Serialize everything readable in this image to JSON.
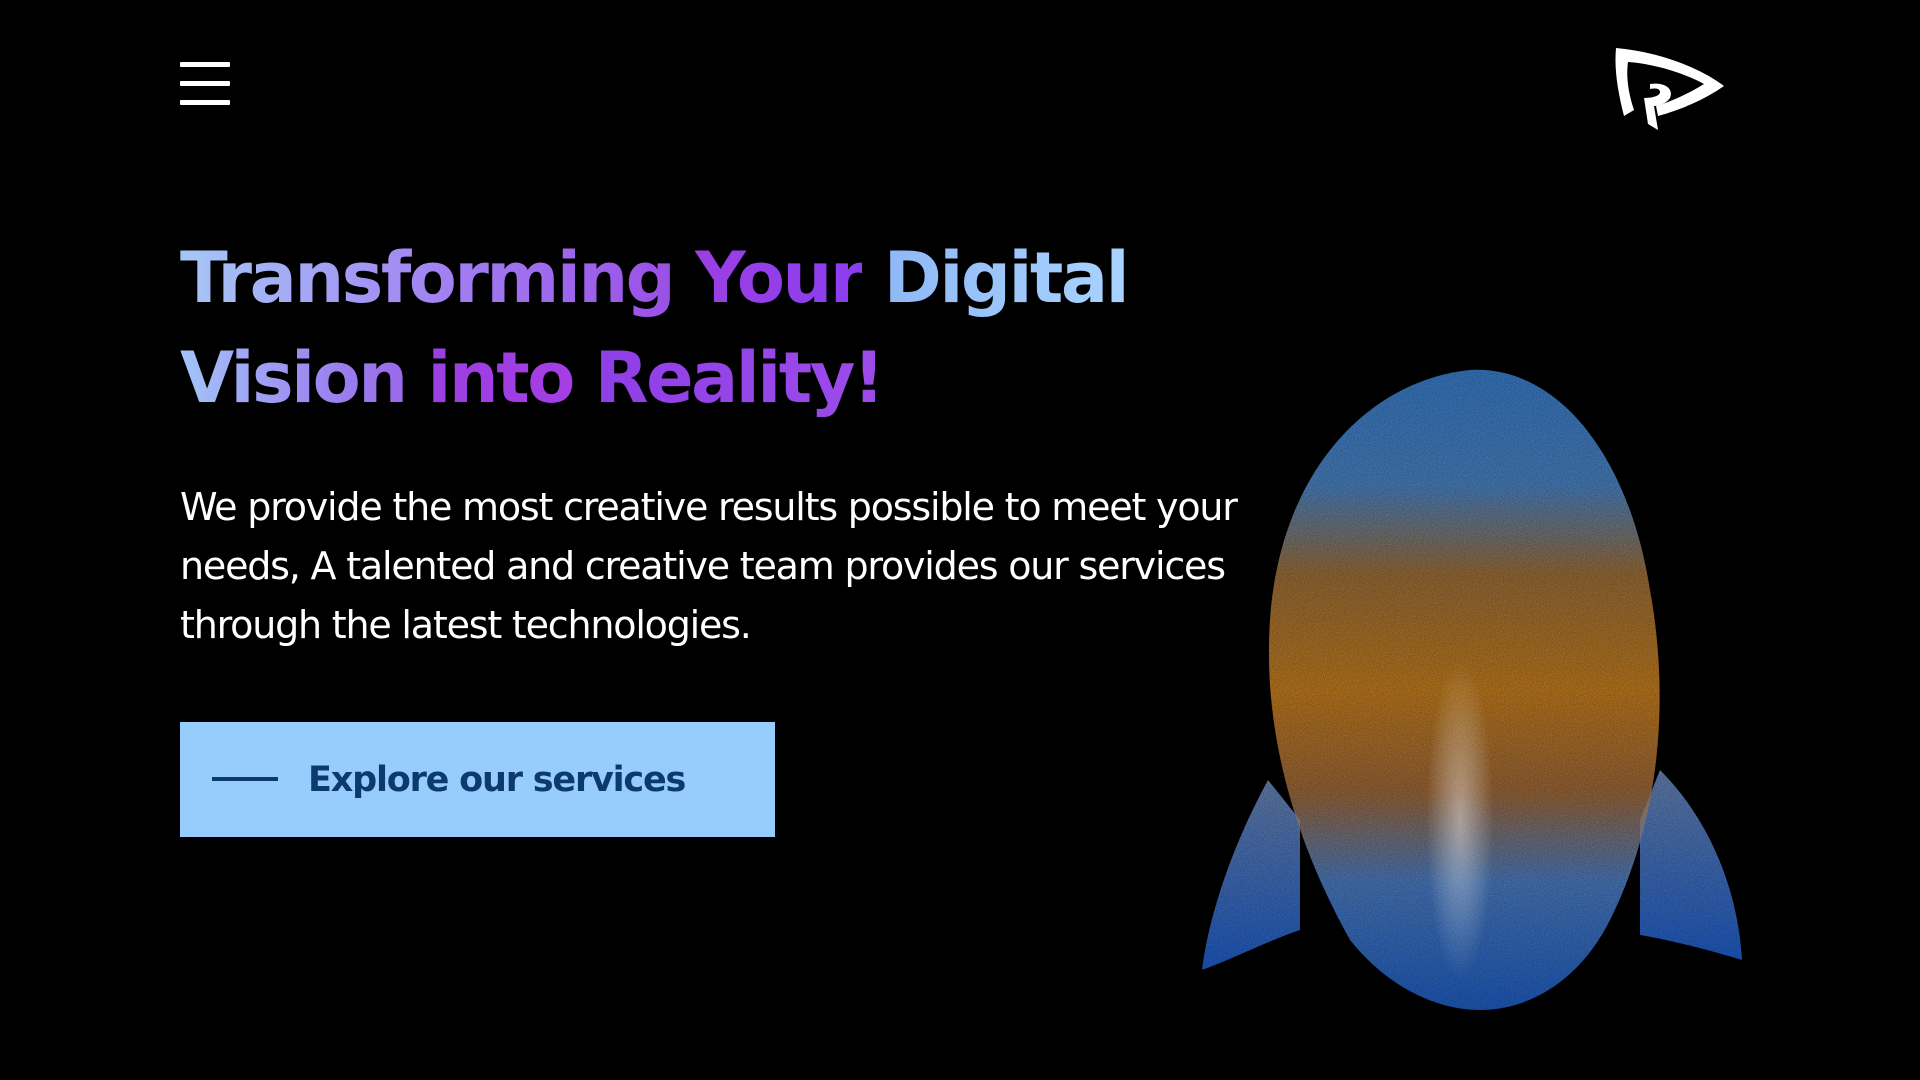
{
  "header": {
    "menu_icon": "hamburger-menu-icon",
    "logo_icon": "brand-logo-icon"
  },
  "hero": {
    "headline": {
      "line1": [
        "Transforming",
        "Your",
        "Digital"
      ],
      "line2": [
        "Vision",
        "into",
        "Reality!"
      ]
    },
    "description": "We provide the most creative results possible to meet your needs, A talented and creative team provides our services through the latest technologies.",
    "cta_label": "Explore our services",
    "illustration": "rocket-illustration"
  },
  "colors": {
    "background": "#000000",
    "cta_background": "#96cdfc",
    "cta_text": "#0d3a6e",
    "headline_purple": "#9b3fe2",
    "headline_blue": "#a6c8f6"
  }
}
